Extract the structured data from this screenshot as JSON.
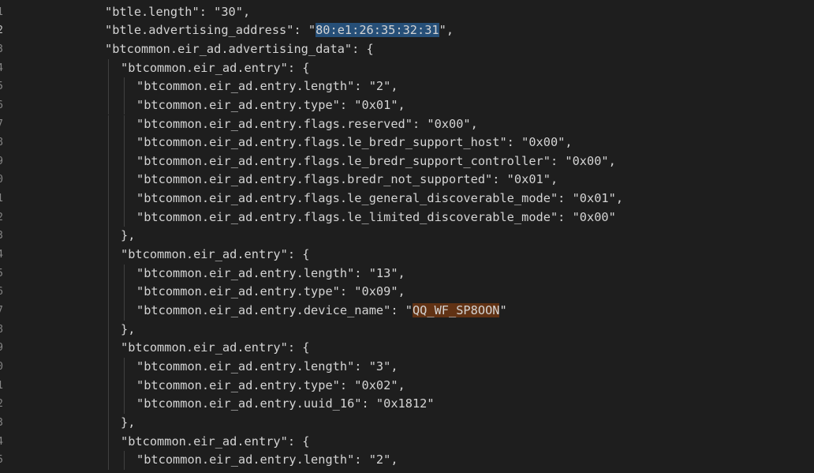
{
  "editor": {
    "colors": {
      "background": "#1e1e1e",
      "text": "#d4d4d4",
      "line_number": "#858585",
      "selection": "#264f78",
      "find_match": "#613214"
    },
    "lines": [
      {
        "num": "1",
        "indent": 0,
        "text": "\"btle.length\": \"30\","
      },
      {
        "num": "2",
        "indent": 0,
        "active": true,
        "pre": "\"btle.advertising_address\": \"",
        "highlight": "80:e1:26:35:32:31",
        "highlight_kind": "selection",
        "post": "\","
      },
      {
        "num": "3",
        "indent": 0,
        "text": "\"btcommon.eir_ad.advertising_data\": {"
      },
      {
        "num": "4",
        "indent": 1,
        "text": "\"btcommon.eir_ad.entry\": {"
      },
      {
        "num": "5",
        "indent": 2,
        "text": "\"btcommon.eir_ad.entry.length\": \"2\","
      },
      {
        "num": "6",
        "indent": 2,
        "text": "\"btcommon.eir_ad.entry.type\": \"0x01\","
      },
      {
        "num": "7",
        "indent": 2,
        "text": "\"btcommon.eir_ad.entry.flags.reserved\": \"0x00\","
      },
      {
        "num": "8",
        "indent": 2,
        "text": "\"btcommon.eir_ad.entry.flags.le_bredr_support_host\": \"0x00\","
      },
      {
        "num": "9",
        "indent": 2,
        "text": "\"btcommon.eir_ad.entry.flags.le_bredr_support_controller\": \"0x00\","
      },
      {
        "num": "0",
        "indent": 2,
        "text": "\"btcommon.eir_ad.entry.flags.bredr_not_supported\": \"0x01\","
      },
      {
        "num": "1",
        "indent": 2,
        "text": "\"btcommon.eir_ad.entry.flags.le_general_discoverable_mode\": \"0x01\","
      },
      {
        "num": "2",
        "indent": 2,
        "text": "\"btcommon.eir_ad.entry.flags.le_limited_discoverable_mode\": \"0x00\""
      },
      {
        "num": "3",
        "indent": 1,
        "text": "},"
      },
      {
        "num": "4",
        "indent": 1,
        "text": "\"btcommon.eir_ad.entry\": {"
      },
      {
        "num": "5",
        "indent": 2,
        "text": "\"btcommon.eir_ad.entry.length\": \"13\","
      },
      {
        "num": "6",
        "indent": 2,
        "text": "\"btcommon.eir_ad.entry.type\": \"0x09\","
      },
      {
        "num": "7",
        "indent": 2,
        "pre": "\"btcommon.eir_ad.entry.device_name\": \"",
        "highlight": "QQ_WF_SP8OON",
        "highlight_kind": "find",
        "post": "\""
      },
      {
        "num": "8",
        "indent": 1,
        "text": "},"
      },
      {
        "num": "9",
        "indent": 1,
        "text": "\"btcommon.eir_ad.entry\": {"
      },
      {
        "num": "0",
        "indent": 2,
        "text": "\"btcommon.eir_ad.entry.length\": \"3\","
      },
      {
        "num": "1",
        "indent": 2,
        "text": "\"btcommon.eir_ad.entry.type\": \"0x02\","
      },
      {
        "num": "2",
        "indent": 2,
        "text": "\"btcommon.eir_ad.entry.uuid_16\": \"0x1812\""
      },
      {
        "num": "3",
        "indent": 1,
        "text": "},"
      },
      {
        "num": "4",
        "indent": 1,
        "text": "\"btcommon.eir_ad.entry\": {"
      },
      {
        "num": "5",
        "indent": 2,
        "text": "\"btcommon.eir_ad.entry.length\": \"2\","
      }
    ]
  }
}
